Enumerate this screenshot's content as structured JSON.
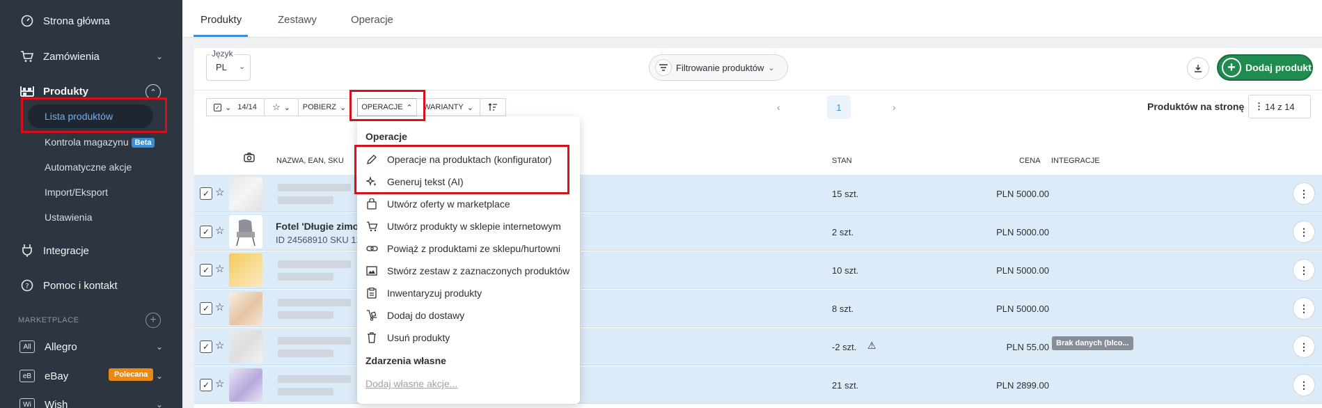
{
  "sidebar": {
    "home": "Strona główna",
    "orders": "Zamówienia",
    "products": "Produkty",
    "sub": [
      "Lista produktów",
      "Kontrola magazynu",
      "Automatyczne akcje",
      "Import/Eksport",
      "Ustawienia"
    ],
    "beta": "Beta",
    "integrations": "Integracje",
    "help": "Pomoc i kontakt",
    "marketplace_heading": "MARKETPLACE",
    "marketplaces": [
      {
        "badge": "All",
        "label": "Allegro"
      },
      {
        "badge": "eB",
        "label": "eBay"
      },
      {
        "badge": "Wi",
        "label": "Wish"
      }
    ],
    "polecana": "Polecana"
  },
  "tabs": [
    "Produkty",
    "Zestawy",
    "Operacje"
  ],
  "filters": {
    "language_label": "Język",
    "language_value": "PL",
    "filter_button": "Filtrowanie produktów",
    "add_product": "Dodaj produkt"
  },
  "toolbar": {
    "selected": "14/14",
    "pobierz": "POBIERZ",
    "operacje": "OPERACJE",
    "warianty": "WARIANTY",
    "page": "1",
    "per_page_label": "Produktów na stronę",
    "per_page_value": "14 z 14"
  },
  "table": {
    "headers": {
      "name": "NAZWA, EAN, SKU",
      "stan": "STAN",
      "cena": "CENA",
      "integracje": "INTEGRACJE"
    },
    "rows": [
      {
        "name": "",
        "id": "",
        "stan": "15 szt.",
        "cena": "PLN 5000.00",
        "integ": ""
      },
      {
        "name": "Fotel 'Długie zimow",
        "id": "ID 24568910 SKU 12",
        "stan": "2 szt.",
        "cena": "PLN 5000.00",
        "integ": ""
      },
      {
        "name": "",
        "id": "",
        "stan": "10 szt.",
        "cena": "PLN 5000.00",
        "integ": ""
      },
      {
        "name": "",
        "id": "",
        "stan": "8 szt.",
        "cena": "PLN 5000.00",
        "integ": ""
      },
      {
        "name": "",
        "id": "",
        "stan": "-2 szt.",
        "cena": "PLN 55.00",
        "integ": "Brak danych (blco..."
      },
      {
        "name": "",
        "id": "",
        "stan": "21 szt.",
        "cena": "PLN 2899.00",
        "integ": ""
      }
    ]
  },
  "dropdown": {
    "heading": "Operacje",
    "items": [
      "Operacje na produktach (konfigurator)",
      "Generuj tekst (AI)",
      "Utwórz oferty w marketplace",
      "Utwórz produkty w sklepie internetowym",
      "Powiąż z produktami ze sklepu/hurtowni",
      "Stwórz zestaw z zaznaczonych produktów",
      "Inwentaryzuj produkty",
      "Dodaj do dostawy",
      "Usuń produkty"
    ],
    "custom_heading": "Zdarzenia własne",
    "custom_link": "Dodaj własne akcje..."
  }
}
